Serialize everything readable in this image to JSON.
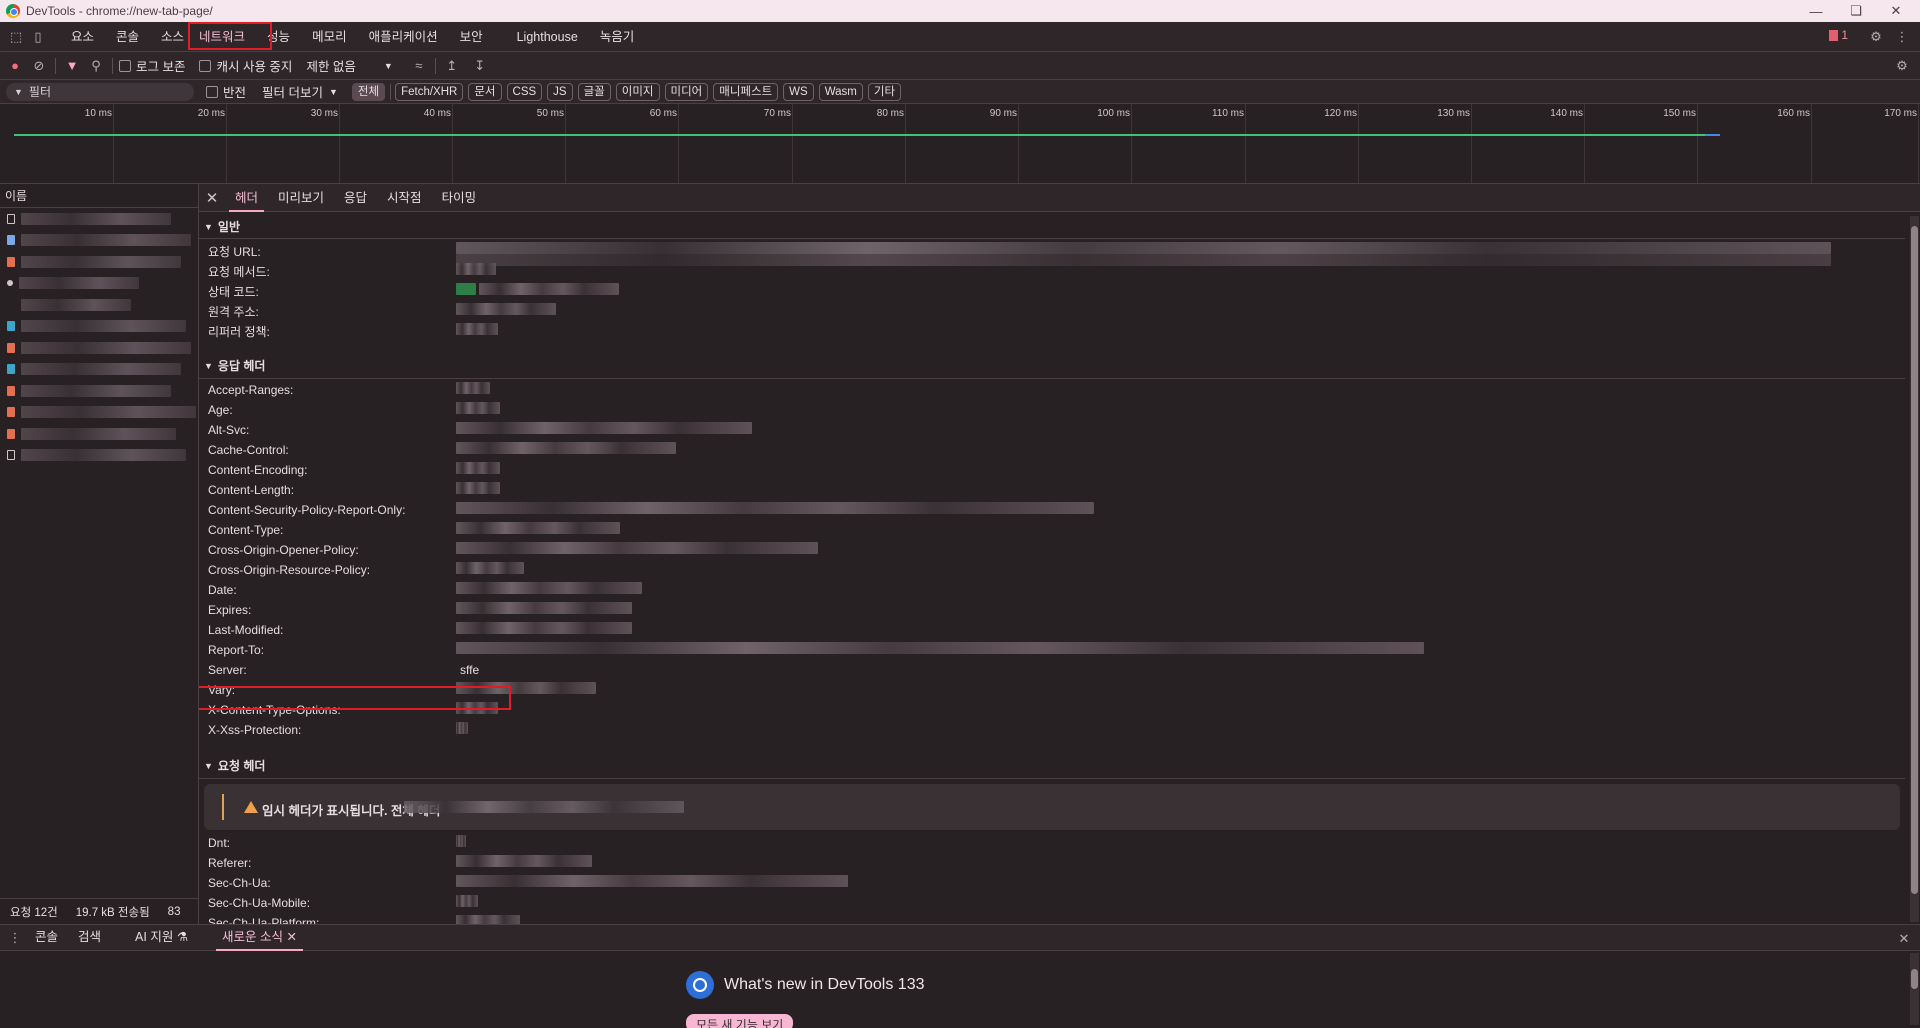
{
  "window": {
    "title": "DevTools - chrome://new-tab-page/"
  },
  "main_tabs": [
    {
      "label": "요소"
    },
    {
      "label": "콘솔"
    },
    {
      "label": "소스"
    },
    {
      "label": "네트워크"
    },
    {
      "label": "성능"
    },
    {
      "label": "메모리"
    },
    {
      "label": "애플리케이션"
    },
    {
      "label": "보안"
    },
    {
      "label": "Lighthouse"
    },
    {
      "label": "녹음기"
    }
  ],
  "issues": {
    "count": "1"
  },
  "toolbar": {
    "preserve_log": "로그 보존",
    "disable_cache": "캐시 사용 중지",
    "throttle": "제한 없음"
  },
  "filterbar": {
    "placeholder": "필터",
    "invert": "반전",
    "more_filters": "필터 더보기",
    "chips": [
      "전체",
      "Fetch/XHR",
      "문서",
      "CSS",
      "JS",
      "글꼴",
      "이미지",
      "미디어",
      "매니페스트",
      "WS",
      "Wasm",
      "기타"
    ]
  },
  "timeline": {
    "ticks": [
      "10 ms",
      "20 ms",
      "30 ms",
      "40 ms",
      "50 ms",
      "60 ms",
      "70 ms",
      "80 ms",
      "90 ms",
      "100 ms",
      "110 ms",
      "120 ms",
      "130 ms",
      "140 ms",
      "150 ms",
      "160 ms",
      "170 ms"
    ]
  },
  "request_list": {
    "header": "이름",
    "status": {
      "requests": "요청 12건",
      "transferred": "19.7 kB 전송됨",
      "more": "83"
    }
  },
  "detail_tabs": [
    {
      "label": "헤더"
    },
    {
      "label": "미리보기"
    },
    {
      "label": "응답"
    },
    {
      "label": "시작점"
    },
    {
      "label": "타이밍"
    }
  ],
  "general": {
    "title": "일반",
    "rows": [
      "요청 URL:",
      "요청 메서드:",
      "상태 코드:",
      "원격 주소:",
      "리퍼러 정책:"
    ]
  },
  "response_headers": {
    "title": "응답 헤더",
    "rows": [
      "Accept-Ranges:",
      "Age:",
      "Alt-Svc:",
      "Cache-Control:",
      "Content-Encoding:",
      "Content-Length:",
      "Content-Security-Policy-Report-Only:",
      "Content-Type:",
      "Cross-Origin-Opener-Policy:",
      "Cross-Origin-Resource-Policy:",
      "Date:",
      "Expires:",
      "Last-Modified:",
      "Report-To:",
      "Server:",
      "Vary:",
      "X-Content-Type-Options:",
      "X-Xss-Protection:"
    ],
    "server_value": "sffe"
  },
  "request_headers": {
    "title": "요청 헤더",
    "warning": "임시 헤더가 표시됩니다. 전체 헤더",
    "rows": [
      "Dnt:",
      "Referer:",
      "Sec-Ch-Ua:",
      "Sec-Ch-Ua-Mobile:",
      "Sec-Ch-Ua-Platform:"
    ]
  },
  "drawer": {
    "tabs": [
      "콘솔",
      "검색",
      "AI 지원",
      "새로운 소식"
    ],
    "whats_new": "What's new in DevTools 133",
    "button": "모든 새 기능 보기"
  }
}
